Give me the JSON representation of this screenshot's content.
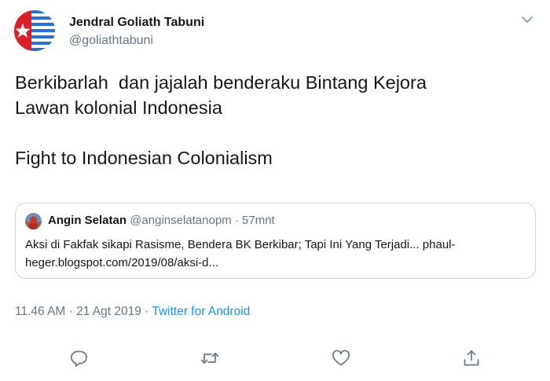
{
  "author": {
    "name": "Jendral Goliath Tabuni",
    "handle": "@goliathtabuni",
    "avatar_colors": {
      "red": "#d8202b",
      "blue": "#2a6fc9",
      "white": "#ffffff"
    }
  },
  "tweet": {
    "lines": [
      "Berkibarlah  dan jajalah benderaku Bintang Kejora",
      "Lawan kolonial Indonesia",
      "",
      "Fight to Indonesian Colonialism"
    ]
  },
  "quoted": {
    "name": "Angin Selatan",
    "handle": "@anginselatanopm",
    "separator": "·",
    "time": "57mnt",
    "lines": [
      "Aksi di Fakfak sikapi Rasisme, Bendera BK Berkibar; Tapi Ini Yang Terjadi... phaul-",
      "heger.blogspot.com/2019/08/aksi-d..."
    ]
  },
  "meta": {
    "timestamp": "11.46 AM · 21 Agt 2019",
    "separator": " · ",
    "source": "Twitter for Android"
  },
  "icons": {
    "caret": "chevron-down-icon",
    "reply": "reply-icon",
    "retweet": "retweet-icon",
    "like": "heart-icon",
    "share": "share-icon"
  },
  "colors": {
    "text": "#14171a",
    "muted": "#657786",
    "link": "#1b95e0",
    "border": "#ccd6dd",
    "icon": "#657786"
  }
}
